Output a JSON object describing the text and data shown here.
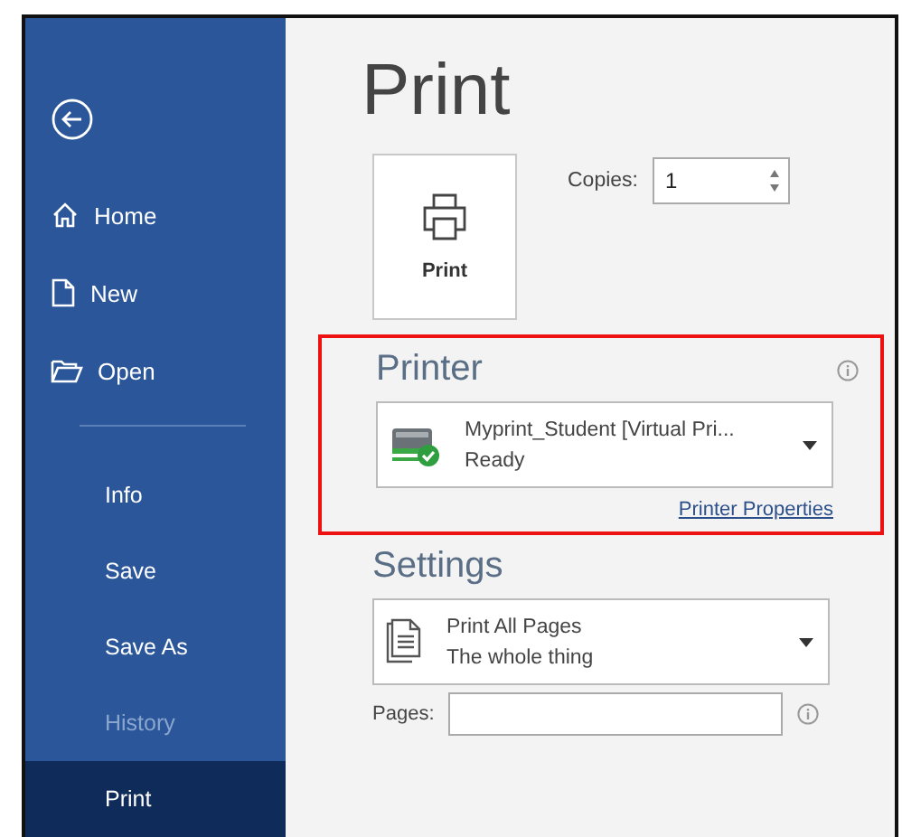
{
  "sidebar": {
    "nav": [
      {
        "label": "Home",
        "selected": false
      },
      {
        "label": "New",
        "selected": false
      },
      {
        "label": "Open",
        "selected": false
      }
    ],
    "items": [
      {
        "label": "Info",
        "selected": false,
        "disabled": false
      },
      {
        "label": "Save",
        "selected": false,
        "disabled": false
      },
      {
        "label": "Save As",
        "selected": false,
        "disabled": false
      },
      {
        "label": "History",
        "selected": false,
        "disabled": true
      },
      {
        "label": "Print",
        "selected": true,
        "disabled": false
      }
    ]
  },
  "title": "Print",
  "print_button": {
    "label": "Print"
  },
  "copies": {
    "label": "Copies:",
    "value": "1"
  },
  "printer": {
    "heading": "Printer",
    "name": "Myprint_Student [Virtual Pri...",
    "status": "Ready",
    "link": "Printer Properties",
    "highlighted": true
  },
  "settings": {
    "heading": "Settings",
    "option": "Print All Pages",
    "description": "The whole thing"
  },
  "pages": {
    "label": "Pages:"
  }
}
